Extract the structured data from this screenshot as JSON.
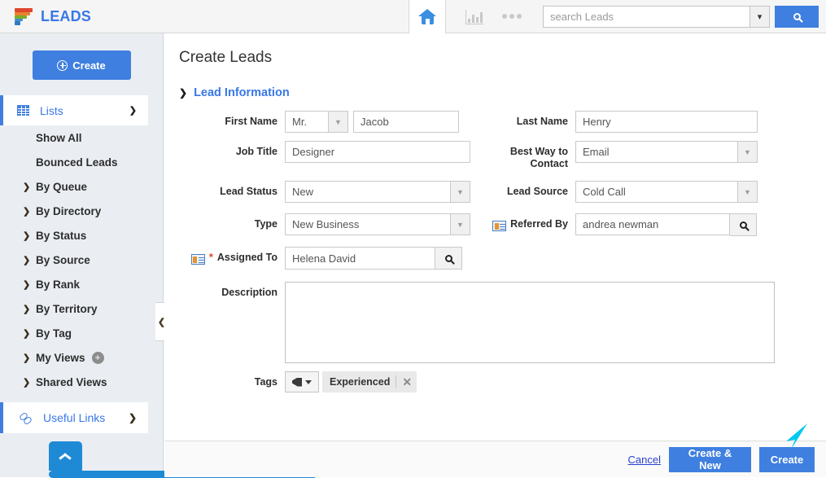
{
  "app": {
    "brand_title": "LEADS",
    "brand_icon": "funnel-icon",
    "home_icon": "home-icon",
    "chart_icon": "bar-chart-icon",
    "more_icon": "ellipsis-icon",
    "accent_blue": "#3f7fe0",
    "link_blue": "#3877e8",
    "sidebar_bg": "#eaeef2"
  },
  "search": {
    "placeholder": "search Leads",
    "value": "",
    "dropdown_icon": "chevron-down-icon",
    "submit_icon": "search-icon"
  },
  "sidebar": {
    "create_label": "Create",
    "create_icon": "plus-circle-icon",
    "lists": {
      "label": "Lists",
      "icon": "grid-icon",
      "expand_icon": "chevron-down-icon"
    },
    "items": [
      {
        "label": "Show All",
        "arrow": ""
      },
      {
        "label": "Bounced Leads",
        "arrow": ""
      },
      {
        "label": "By Queue",
        "arrow": "❯"
      },
      {
        "label": "By Directory",
        "arrow": "❯"
      },
      {
        "label": "By Status",
        "arrow": "❯"
      },
      {
        "label": "By Source",
        "arrow": "❯"
      },
      {
        "label": "By Rank",
        "arrow": "❯"
      },
      {
        "label": "By Territory",
        "arrow": "❯"
      },
      {
        "label": "By Tag",
        "arrow": "❯"
      },
      {
        "label": "My Views",
        "arrow": "❯",
        "badge": "+"
      },
      {
        "label": "Shared Views",
        "arrow": "❯"
      }
    ],
    "useful_links": {
      "label": "Useful Links",
      "icon": "link-icon",
      "expand_icon": "chevron-right-icon"
    },
    "scroll_top_icon": "chevron-up-icon",
    "collapse_icon": "chevron-left-icon"
  },
  "main": {
    "page_title": "Create Leads",
    "section": {
      "title": "Lead Information",
      "collapse_icon": "chevron-down-icon"
    },
    "fields": {
      "first_name": {
        "label": "First Name",
        "salutation_value": "Mr.",
        "salutation_arrow": "▼",
        "value": "Jacob"
      },
      "last_name": {
        "label": "Last Name",
        "value": "Henry"
      },
      "job_title": {
        "label": "Job Title",
        "value": "Designer"
      },
      "best_way_to_contact": {
        "label": "Best Way to\nContact",
        "value": "Email",
        "arrow": "▼"
      },
      "lead_status": {
        "label": "Lead Status",
        "value": "New",
        "arrow": "▼"
      },
      "lead_source": {
        "label": "Lead Source",
        "value": "Cold Call",
        "arrow": "▼"
      },
      "type": {
        "label": "Type",
        "value": "New Business",
        "arrow": "▼"
      },
      "referred_by": {
        "label": "Referred By",
        "value": "andrea newman",
        "icon": "contact-card-icon",
        "lookup_icon": "search-icon"
      },
      "assigned_to": {
        "label": "Assigned To",
        "value": "Helena David",
        "required_marker": "*",
        "icon": "contact-card-icon",
        "lookup_icon": "search-icon"
      },
      "description": {
        "label": "Description",
        "value": "",
        "placeholder": ""
      },
      "tags": {
        "label": "Tags",
        "dropdown_icon": "tag-icon",
        "dropdown_caret": "chevron-down-icon",
        "chips": [
          {
            "label": "Experienced",
            "remove_icon": "close-icon",
            "remove_glyph": "✕"
          }
        ]
      }
    }
  },
  "footer": {
    "cancel_label": "Cancel",
    "create_new_label": "Create & New",
    "create_label": "Create"
  }
}
